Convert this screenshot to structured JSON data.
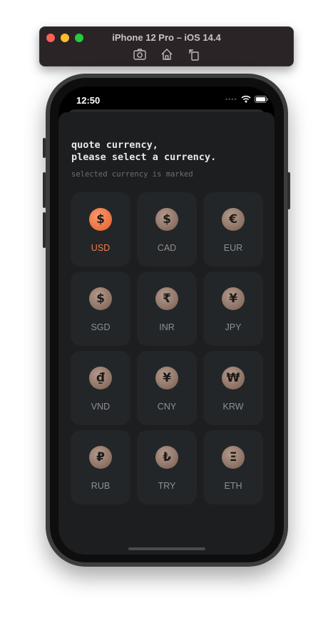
{
  "simulator": {
    "title": "iPhone 12 Pro – iOS 14.4",
    "tools": [
      "camera-icon",
      "home-icon",
      "rotate-icon"
    ]
  },
  "status_bar": {
    "time": "12:50"
  },
  "page": {
    "heading": "quote currency,\nplease select a currency.",
    "subheading": "selected currency is marked"
  },
  "colors": {
    "accent": "#ef7d48",
    "tile_bg": "#232628",
    "sheet_bg": "#1c1e1f",
    "coin": "#8a7062"
  },
  "currencies": [
    {
      "code": "USD",
      "symbol": "$",
      "selected": true
    },
    {
      "code": "CAD",
      "symbol": "$",
      "selected": false
    },
    {
      "code": "EUR",
      "symbol": "€",
      "selected": false
    },
    {
      "code": "SGD",
      "symbol": "$",
      "selected": false
    },
    {
      "code": "INR",
      "symbol": "₹",
      "selected": false
    },
    {
      "code": "JPY",
      "symbol": "¥",
      "selected": false
    },
    {
      "code": "VND",
      "symbol": "₫",
      "selected": false
    },
    {
      "code": "CNY",
      "symbol": "¥",
      "selected": false
    },
    {
      "code": "KRW",
      "symbol": "₩",
      "selected": false
    },
    {
      "code": "RUB",
      "symbol": "₽",
      "selected": false
    },
    {
      "code": "TRY",
      "symbol": "₺",
      "selected": false
    },
    {
      "code": "ETH",
      "symbol": "Ξ",
      "selected": false
    }
  ]
}
